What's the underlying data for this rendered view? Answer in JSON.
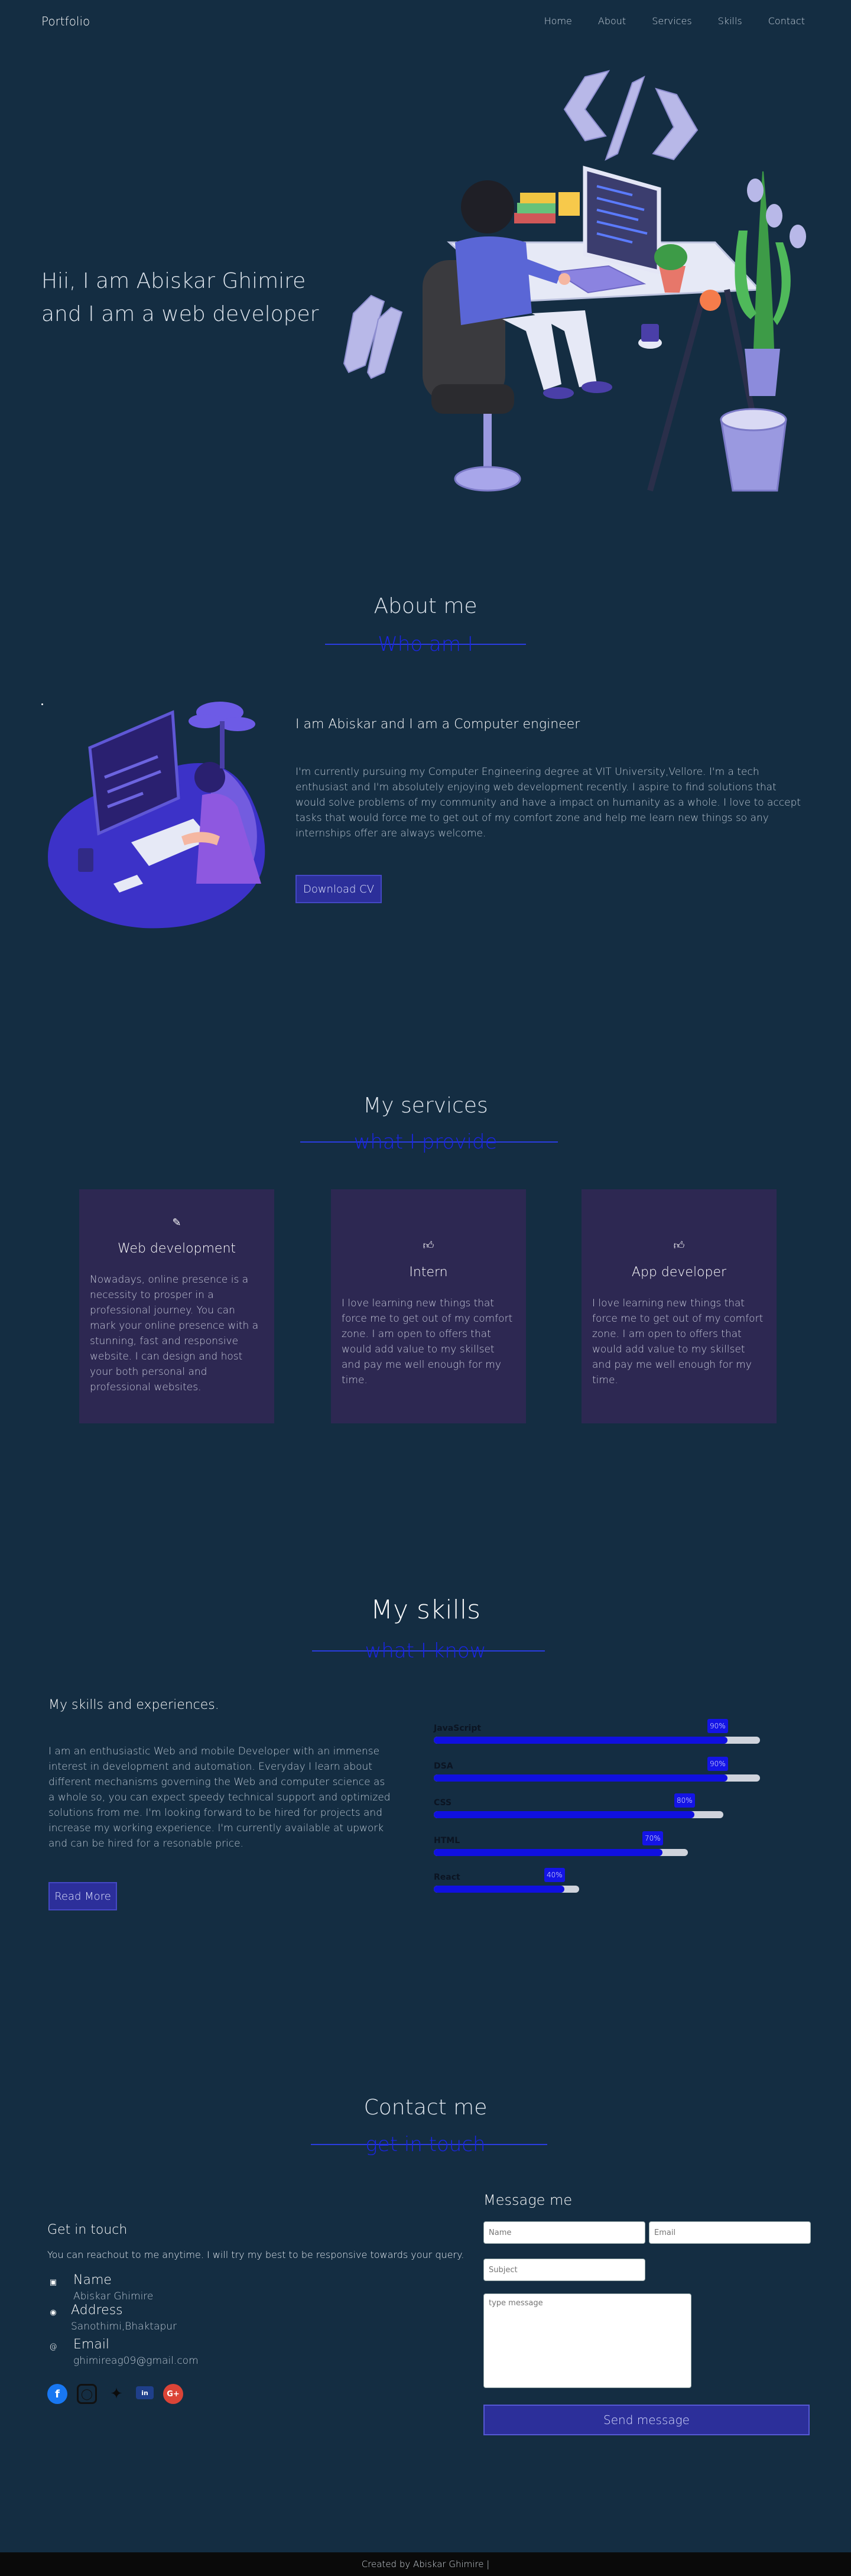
{
  "nav": {
    "brand": "Portfolio",
    "links": [
      "Home",
      "About",
      "Services",
      "Skills",
      "Contact"
    ]
  },
  "hero": {
    "line1": "Hii, I am Abiskar Ghimire",
    "line2": "and I am a web developer"
  },
  "about": {
    "title": "About me",
    "subtitle": "Who am I",
    "heading": "I am Abiskar and I am a Computer engineer",
    "paragraph": "I'm currently pursuing my Computer Engineering degree at VIT University,Vellore. I'm a tech enthusiast and I'm absolutely enjoying web development recently. I aspire to find solutions that would solve problems of my community and have a impact on humanity as a whole. I love to accept tasks that would force me to get out of my comfort zone and help me learn new things so any internships offer are always welcome.",
    "button": "Download CV"
  },
  "services": {
    "title": "My services",
    "subtitle": "what I provide",
    "cards": [
      {
        "icon": "edit-icon",
        "title": "Web development",
        "text": "Nowadays, online presence is a necessity to prosper in a professional journey. You can mark your online presence with a stunning, fast and responsive website. I can design and host your both personal and professional websites."
      },
      {
        "icon": "thumbs-up-icon",
        "title": "Intern",
        "text": "I love learning new things that force me to get out of my comfort zone. I am open to offers that would add value to my skillset and pay me well enough for my time."
      },
      {
        "icon": "thumbs-up-icon",
        "title": "App developer",
        "text": "I love learning new things that force me to get out of my comfort zone. I am open to offers that would add value to my skillset and pay me well enough for my time."
      }
    ]
  },
  "skills": {
    "title": "My skills",
    "subtitle": "what I know",
    "heading": "My skills and experiences.",
    "paragraph": "I am an enthusiastic Web and mobile Developer with an immense interest in development and automation. Everyday I learn about different mechanisms governing the Web and computer science as a whole so, you can expect speedy technical support and optimized solutions from me. I'm looking forward to be hired for projects and increase my working experience. I'm currently available at upwork and can be hired for a resonable price.",
    "button": "Read More",
    "bars": [
      {
        "label": "JavaScript",
        "percent": 90,
        "badge": "90%"
      },
      {
        "label": "DSA",
        "percent": 90,
        "badge": "90%"
      },
      {
        "label": "CSS",
        "percent": 80,
        "badge": "80%"
      },
      {
        "label": "HTML",
        "percent": 70,
        "badge": "70%"
      },
      {
        "label": "React",
        "percent": 40,
        "badge": "40%"
      }
    ]
  },
  "contact": {
    "title": "Contact me",
    "subtitle": "get in touch",
    "get_in_touch": "Get in touch",
    "intro": "You can reachout to me anytime. I will try my best to be responsive towards your query.",
    "name_label": "Name",
    "name_value": "Abiskar Ghimire",
    "address_label": "Address",
    "address_value": "Sanothimi,Bhaktapur",
    "email_label": "Email",
    "email_value": "ghimireag09@gmail.com",
    "form_title": "Message me",
    "name_placeholder": "Name",
    "email_placeholder": "Email",
    "subject_placeholder": "Subject",
    "message_placeholder": "type message",
    "send": "Send message"
  },
  "footer": {
    "text": "Created by Abiskar Ghimire |"
  },
  "colors": {
    "background": "#142d42",
    "accent": "#1a25e8",
    "card": "#2d2852",
    "button": "#2c2f9a"
  }
}
